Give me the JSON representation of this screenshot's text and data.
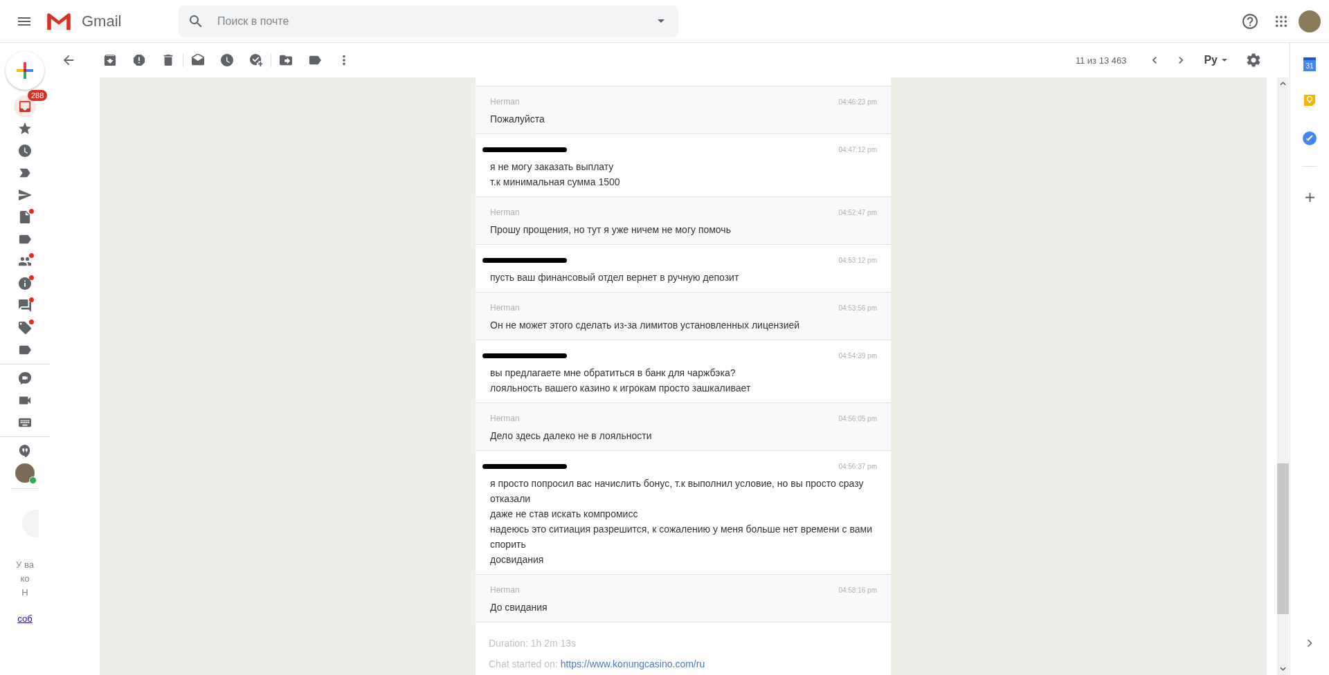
{
  "header": {
    "product": "Gmail",
    "search": {
      "placeholder": "Поиск в почте"
    }
  },
  "sidebar": {
    "items": [
      {
        "selected": true,
        "dot": false,
        "badge": "288"
      },
      {
        "selected": false,
        "dot": false
      },
      {
        "selected": false,
        "dot": false
      },
      {
        "selected": false,
        "dot": false
      },
      {
        "selected": false,
        "dot": false
      },
      {
        "selected": false,
        "dot": true
      },
      {
        "selected": false,
        "dot": false
      },
      {
        "selected": false,
        "dot": true
      },
      {
        "selected": false,
        "dot": true
      },
      {
        "selected": false,
        "dot": true
      },
      {
        "selected": false,
        "dot": true
      },
      {
        "selected": false,
        "dot": false
      }
    ],
    "chat": {
      "online": true
    },
    "footer_lines": [
      "У ва",
      "ко",
      "Н"
    ],
    "footer_link": "соб"
  },
  "toolbar": {
    "counter": "11 из 13 463",
    "input_tool": "Ру"
  },
  "messages": [
    {
      "kind": "agent",
      "author": "Herman",
      "time": "04:46:23 pm",
      "lines": [
        "Пожалуйста"
      ]
    },
    {
      "kind": "customer",
      "time": "04:47:12 pm",
      "lines": [
        "я не могу заказать выплату",
        "т.к минимальная сумма 1500"
      ]
    },
    {
      "kind": "agent",
      "author": "Herman",
      "time": "04:52:47 pm",
      "lines": [
        "Прошу прощения, но тут я уже ничем не могу помочь"
      ]
    },
    {
      "kind": "customer",
      "time": "04:53:12 pm",
      "lines": [
        "пусть ваш финансовый отдел вернет в ручную депозит"
      ]
    },
    {
      "kind": "agent",
      "author": "Herman",
      "time": "04:53:56 pm",
      "lines": [
        "Он не может этого сделать из-за лимитов установленных лицензией"
      ]
    },
    {
      "kind": "customer",
      "time": "04:54:39 pm",
      "lines": [
        "вы предлагаете мне обратиться в банк для чаржбэка?",
        "лояльность вашего казино к игрокам просто зашкаливает"
      ]
    },
    {
      "kind": "agent",
      "author": "Herman",
      "time": "04:56:05 pm",
      "lines": [
        "Дело здесь далеко не в лояльности"
      ]
    },
    {
      "kind": "customer",
      "time": "04:56:37 pm",
      "lines": [
        "я просто попросил вас начислить бонус, т.к выполнил условие, но вы просто сразу отказали",
        "даже не став искать компромисс",
        "надеюсь это ситиация разрешится, к сожалению у меня больше нет времени с вами спорить",
        "досвидания"
      ]
    },
    {
      "kind": "agent",
      "author": "Herman",
      "time": "04:58:16 pm",
      "lines": [
        "До свидания"
      ]
    }
  ],
  "duration": "Duration: 1h 2m 13s",
  "chat_started": {
    "label": "Chat started on:",
    "url": "https://www.konungcasino.com/ru"
  },
  "side_panel": {
    "calendar_date": "31"
  }
}
